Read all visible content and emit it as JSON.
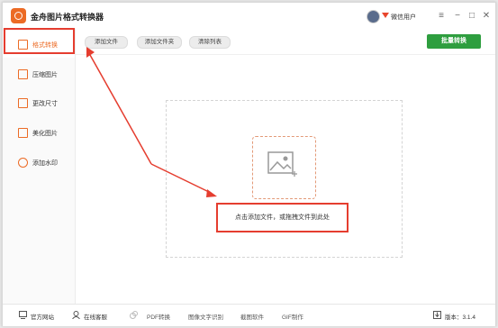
{
  "app": {
    "title": "金舟图片格式转换器",
    "user_label": "微信用户"
  },
  "window_controls": {
    "menu": "≡",
    "minimize": "−",
    "maximize": "□",
    "close": "✕"
  },
  "sidebar": {
    "items": [
      {
        "label": "格式转换",
        "icon": "format-convert-icon",
        "active": true
      },
      {
        "label": "压缩图片",
        "icon": "compress-icon",
        "active": false
      },
      {
        "label": "更改尺寸",
        "icon": "resize-icon",
        "active": false
      },
      {
        "label": "美化图片",
        "icon": "beautify-icon",
        "active": false
      },
      {
        "label": "添加水印",
        "icon": "watermark-icon",
        "active": false
      }
    ]
  },
  "toolbar": {
    "add_file": "添加文件",
    "add_folder": "添加文件夹",
    "clear_list": "清除列表",
    "batch_convert": "批量转换"
  },
  "dropzone": {
    "hint": "点击添加文件，或拖拽文件到此处"
  },
  "statusbar": {
    "items": [
      "官方网站",
      "在线客服",
      "PDF转换",
      "图像文字识别",
      "截图软件",
      "GIF制作"
    ],
    "version": "版本：3.1.4"
  },
  "colors": {
    "accent": "#ec6b25",
    "annotation_red": "#e53d2f",
    "batch_green": "#2e9e3f"
  }
}
